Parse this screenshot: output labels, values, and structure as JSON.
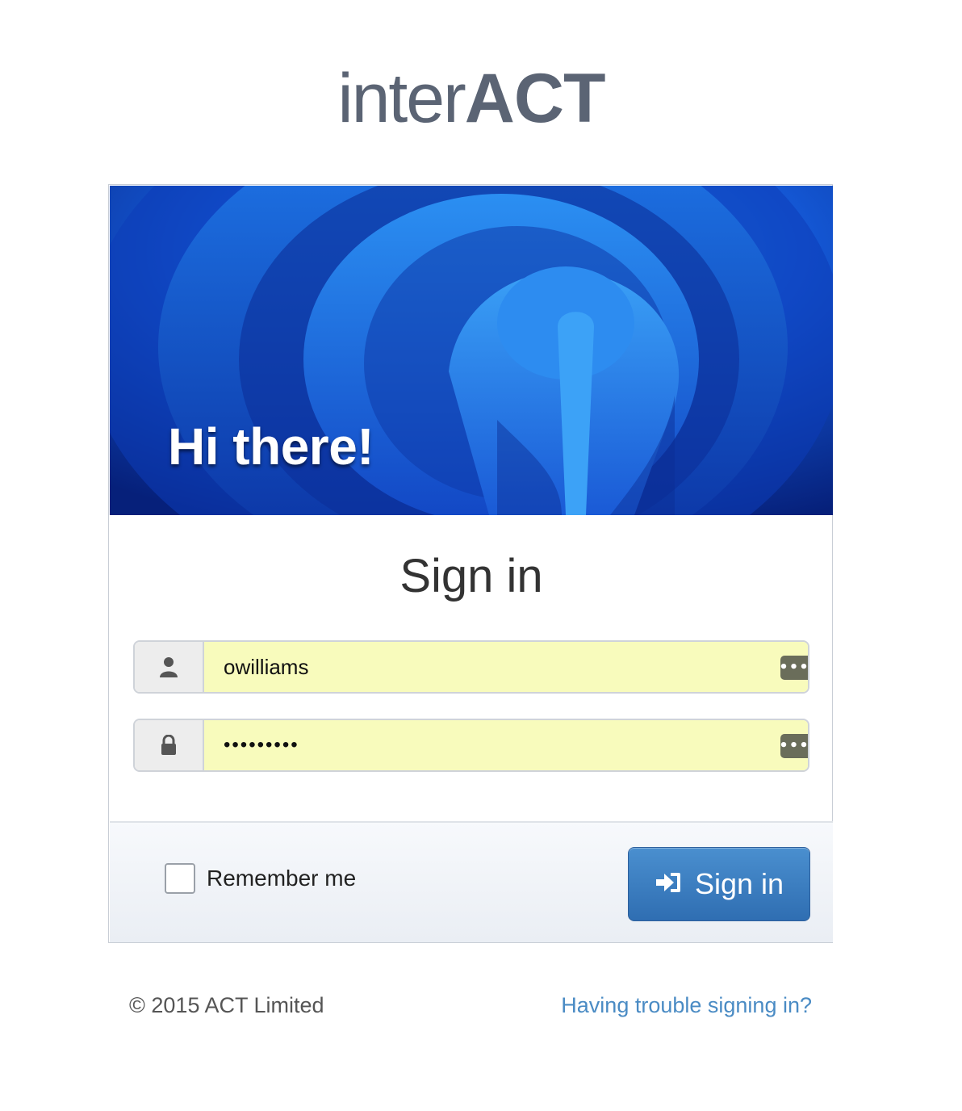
{
  "logo": {
    "light": "inter",
    "bold": "ACT"
  },
  "hero": {
    "title": "Hi there!"
  },
  "form": {
    "title": "Sign in",
    "username": {
      "value": "owilliams",
      "icon": "user-icon"
    },
    "password": {
      "value": "•••••••••",
      "icon": "lock-icon"
    },
    "password_manager_icon": "•••",
    "remember_label": "Remember me",
    "submit_label": "Sign in",
    "submit_icon": "sign-in-icon"
  },
  "footer": {
    "copyright": "© 2015 ACT Limited",
    "trouble_link": "Having trouble signing in?"
  },
  "colors": {
    "brand_text": "#5b6474",
    "button_blue": "#2f6eb2",
    "autofill_yellow": "#f8fbbc",
    "link_blue": "#4a8bc4"
  }
}
